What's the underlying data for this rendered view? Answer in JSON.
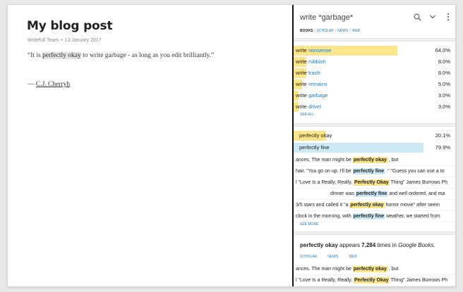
{
  "document": {
    "title": "My blog post",
    "author": "Writefull Team",
    "date": "13 January 2017",
    "quote": {
      "before": "“It is ",
      "highlight": "perfectly okay",
      "after": " to write garbage - as long as you edit brilliantly.”"
    },
    "signature": {
      "dash": "— ",
      "author": "C.J. Cherryh"
    }
  },
  "panel": {
    "query": "write *garbage*",
    "icons": [
      "search-icon",
      "chevron-down-icon",
      "more-vertical-icon"
    ],
    "tabs": [
      "BOOKS",
      "SCHOLAR",
      "NEWS",
      "WEB"
    ],
    "fills": [
      {
        "prefix": "write",
        "word": "nonsense",
        "percent": "64.0%",
        "fraction": 0.64
      },
      {
        "prefix": "write",
        "word": "rubbish",
        "percent": "8.0%",
        "fraction": 0.08
      },
      {
        "prefix": "write",
        "word": "trash",
        "percent": "8.0%",
        "fraction": 0.08
      },
      {
        "prefix": "write",
        "word": "remains",
        "percent": "5.0%",
        "fraction": 0.05
      },
      {
        "prefix": "write",
        "word": "garbage",
        "percent": "3.0%",
        "fraction": 0.03
      },
      {
        "prefix": "write",
        "word": "drivel",
        "percent": "3.0%",
        "fraction": 0.03
      }
    ],
    "see_all": "SEE ALL",
    "compare": [
      {
        "label": "perfectly okay",
        "percent": "20.1%",
        "fraction": 0.201,
        "color": "#fde58c"
      },
      {
        "label": "perfectly fine",
        "percent": "79.9%",
        "fraction": 0.799,
        "color": "#cde9f4"
      }
    ],
    "examples": [
      {
        "before": "ances. The man might be ",
        "key": "perfectly okay",
        "after": " , but",
        "tone": "y"
      },
      {
        "before": "hair. \"You go on up. I'll be ",
        "key": "perfectly fine",
        "after": " .\" \"Guess you can use a to",
        "tone": "b"
      },
      {
        "before": "l \"Love Is a Really, Really, ",
        "key": "Perfectly Okay",
        "after": " Thing\" James Burrows Ph",
        "tone": "y"
      },
      {
        "before": "dinner was ",
        "key": "perfectly fine",
        "after": " and well ordered, and ma",
        "tone": "b",
        "indent": true
      },
      {
        "before": "3/5 stars and called it \"a ",
        "key": "perfectly okay",
        "after": " horror movie\" after seein",
        "tone": "y"
      },
      {
        "before": "clock in the morning, with ",
        "key": "perfectly fine",
        "after": " weather, we started from",
        "tone": "b"
      }
    ],
    "see_more": "SEE MORE",
    "summary": {
      "phrase": "perfectly okay",
      "appears": " appears ",
      "count": "7,284",
      "times_in": " times in ",
      "source": "Google Books",
      "period": "."
    },
    "source_tabs": [
      "SCHOLAR",
      "NEWS",
      "WEB"
    ],
    "summary_examples": [
      {
        "before": "ances. The man might be ",
        "key": "perfectly okay",
        "after": " , but"
      },
      {
        "before": "l \"Love Is a Really, Really, ",
        "key": "Perfectly Okay",
        "after": " Thing\" James Burrows Ph"
      }
    ]
  },
  "colors": {
    "accent": "#2a7ab8",
    "highlight_yellow": "#fde58c",
    "highlight_blue": "#cde9f4",
    "divider": "#111111"
  }
}
